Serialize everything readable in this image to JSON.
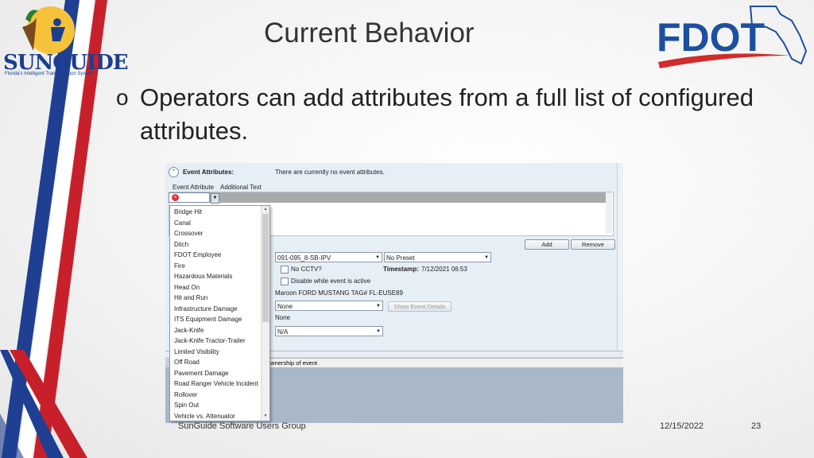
{
  "slide": {
    "title": "Current Behavior",
    "bullet_mark": "o",
    "bullet_text": "Operators can add attributes from a full list of configured attributes."
  },
  "logos": {
    "sunguide_text": "SUNGUIDE",
    "sunguide_sub": "Florida's Intelligent Transportation System",
    "fdot_text": "FDOT"
  },
  "app": {
    "section_title": "Event Attributes:",
    "status": "There are currently no event attributes.",
    "grid_headers": [
      "Event Attribute",
      "Additional Text"
    ],
    "add_label": "Add",
    "remove_label": "Remove",
    "camera_select": "091-095_8-SB-IPV",
    "preset_select": "No Preset",
    "no_cctv_label": "No CCTV?",
    "timestamp_label": "Timestamp:",
    "timestamp_value": "7/12/2021 06:53",
    "disable_label": "Disable while event is active",
    "vehicle_desc": "Maroon FORD MUSTANG TAG# FL-EUSE89",
    "none_select": "None",
    "show_details_label": "Show Event Details",
    "none_text": "None",
    "na_select": "N/A",
    "ownership_text": "ownership of event"
  },
  "dropdown_items": [
    "Bridge Hit",
    "Canal",
    "Crossover",
    "Ditch",
    "FDOT Employee",
    "Fire",
    "Hazardous Materials",
    "Head On",
    "Hit and Run",
    "Infrastructure Damage",
    "ITS Equipment Damage",
    "Jack-Knife",
    "Jack-Knife Tractor-Trailer",
    "Limited Visibility",
    "Off Road",
    "Pavement Damage",
    "Road Ranger Vehicle Incident",
    "Rollover",
    "Spin Out",
    "Vehicle vs. Attenuator"
  ],
  "footer": {
    "left": "SunGuide Software Users Group",
    "date": "12/15/2022",
    "page": "23"
  },
  "colors": {
    "stripe_red": "#c8202a",
    "stripe_blue": "#1f3f93",
    "fdot_blue": "#1d4fa0",
    "fdot_red": "#d32a2a"
  }
}
